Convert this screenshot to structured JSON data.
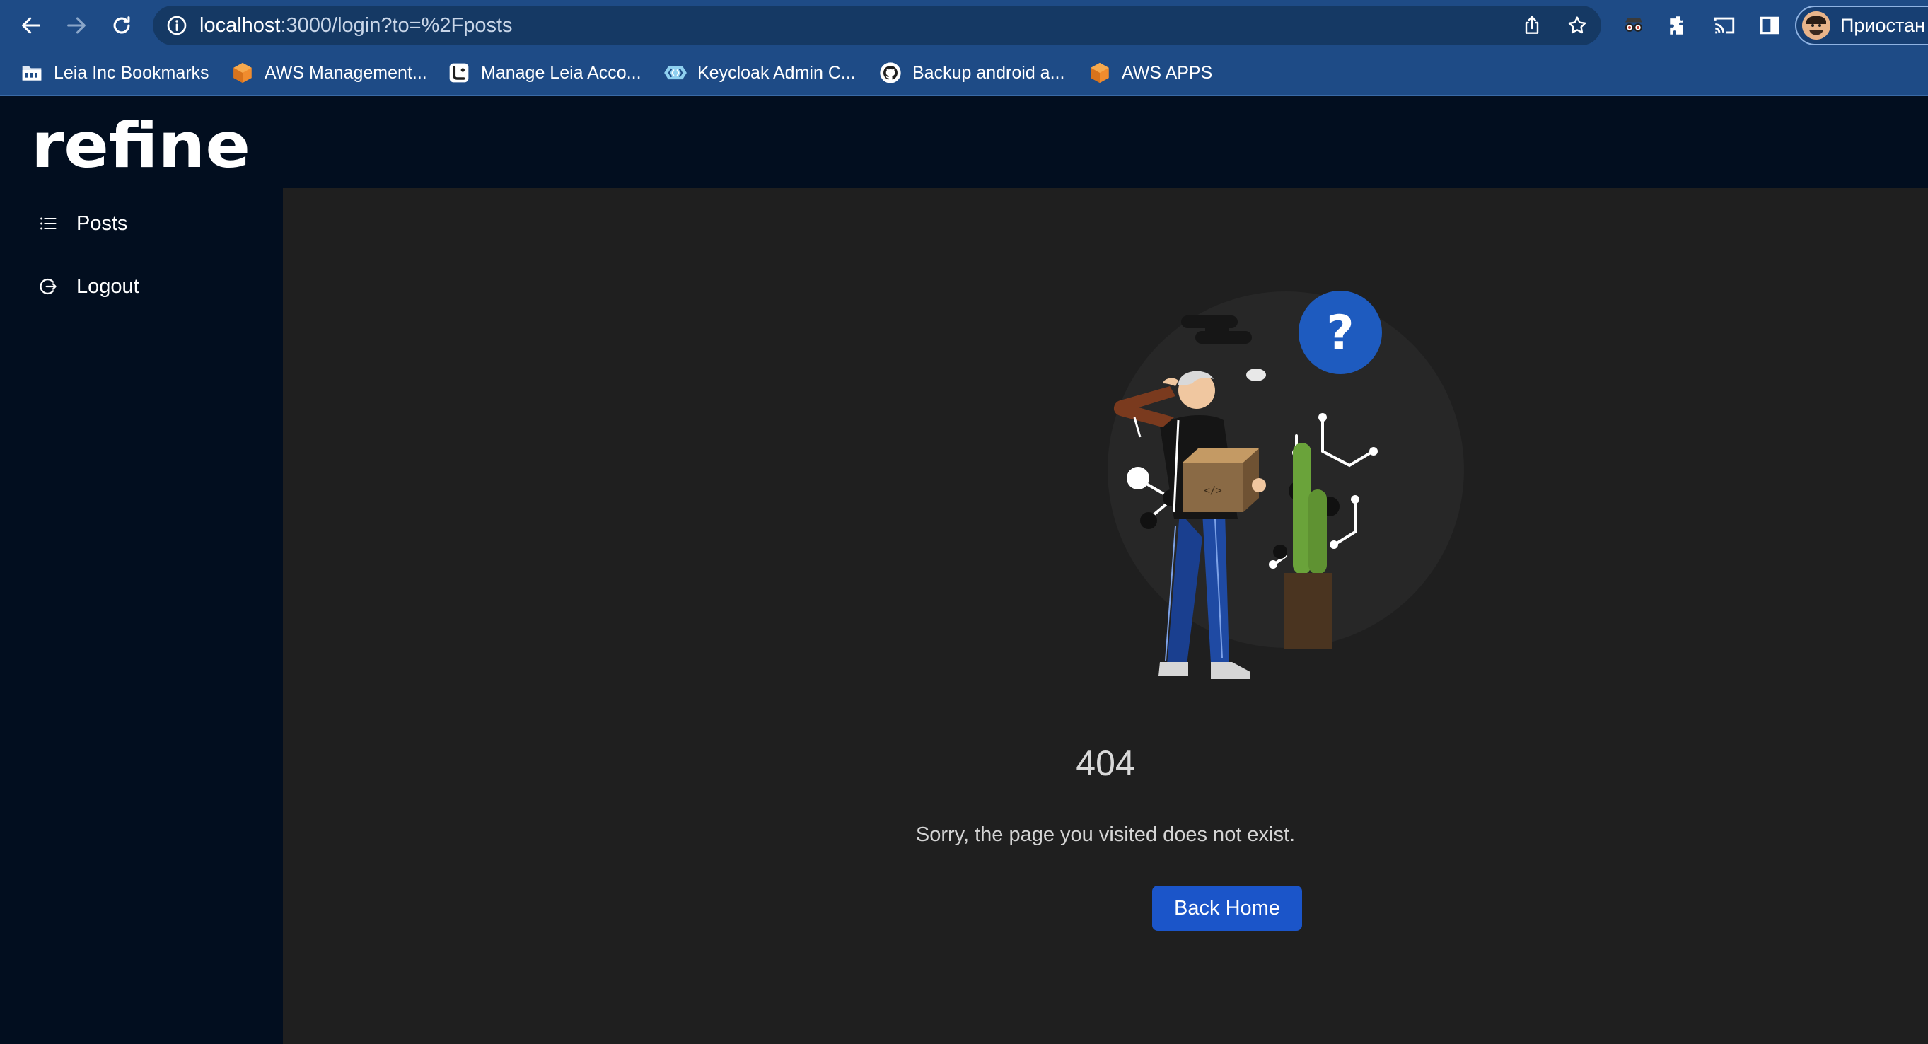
{
  "browser": {
    "url_host": "localhost",
    "url_rest": ":3000/login?to=%2Fposts",
    "profile_label": "Приостан"
  },
  "bookmarks": [
    {
      "label": "Leia Inc Bookmarks",
      "icon": "folder-icon"
    },
    {
      "label": "AWS Management...",
      "icon": "aws-icon"
    },
    {
      "label": "Manage Leia Acco...",
      "icon": "leia-icon"
    },
    {
      "label": "Keycloak Admin C...",
      "icon": "keycloak-icon"
    },
    {
      "label": "Backup android a...",
      "icon": "github-icon"
    },
    {
      "label": "AWS APPS",
      "icon": "aws-icon"
    }
  ],
  "app": {
    "logo_text": "refine",
    "menu": [
      {
        "label": "Posts",
        "icon": "list-icon"
      },
      {
        "label": "Logout",
        "icon": "logout-icon"
      }
    ]
  },
  "result": {
    "code": "404",
    "message": "Sorry, the page you visited does not exist.",
    "button": "Back Home"
  },
  "colors": {
    "chrome": "#1e4b86",
    "sider": "#020e1f",
    "content": "#1f1f1f",
    "primary_button": "#1b55c9"
  }
}
